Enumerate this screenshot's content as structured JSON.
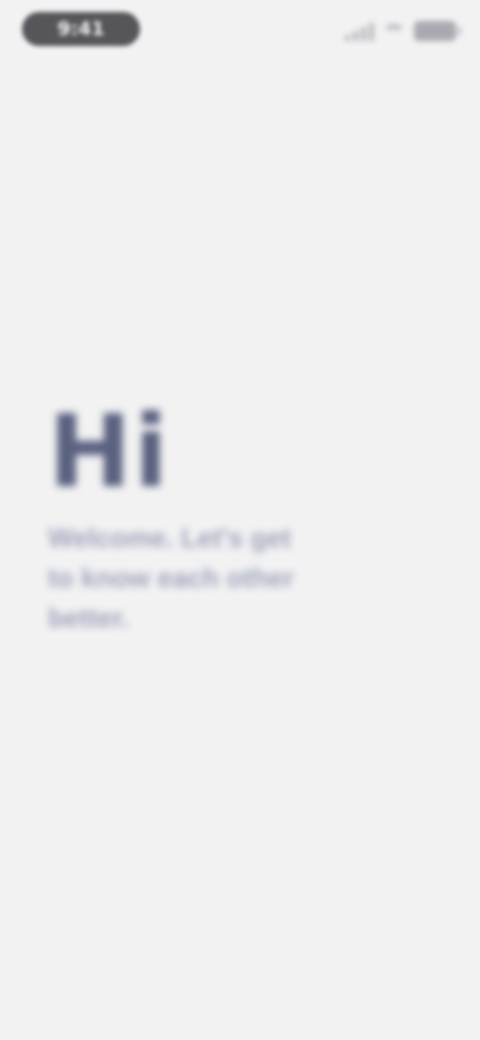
{
  "status_bar": {
    "time": "9:41",
    "icons": [
      "signal-icon",
      "wifi-icon",
      "battery-icon"
    ]
  },
  "hero": {
    "title": "Hi",
    "subtitle": "Welcome. Let's get to know each other better."
  },
  "colors": {
    "background": "#f2f2f3",
    "title": "#59617f",
    "subtitle": "#9ea4ba",
    "time_pill": "#55555a",
    "status_icons": "#b9b9bf"
  }
}
